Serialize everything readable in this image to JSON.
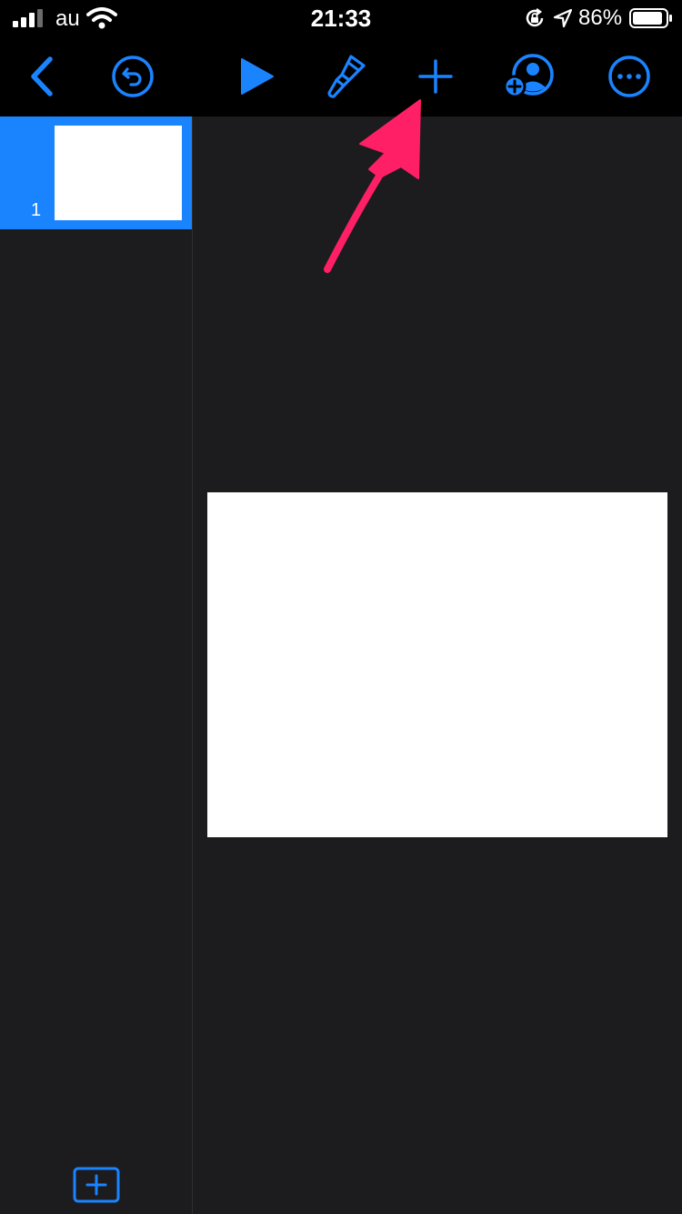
{
  "status_bar": {
    "carrier": "au",
    "time": "21:33",
    "battery_percent": "86%",
    "icons": [
      "signal-icon",
      "wifi-icon",
      "rotation-lock-icon",
      "location-arrow-icon",
      "battery-icon"
    ]
  },
  "toolbar": {
    "buttons": [
      "back-chevron-icon",
      "undo-icon",
      "play-icon",
      "format-brush-icon",
      "add-icon",
      "collaborate-icon",
      "more-icon"
    ],
    "accent_color": "#1a84ff"
  },
  "navigator": {
    "slides": [
      {
        "number": "1"
      }
    ],
    "selected_color": "#1a84ff"
  },
  "annotation": {
    "arrow_color": "#ff1f66"
  },
  "colors": {
    "background": "#1c1c1e",
    "bar": "#000000",
    "slide": "#ffffff"
  }
}
